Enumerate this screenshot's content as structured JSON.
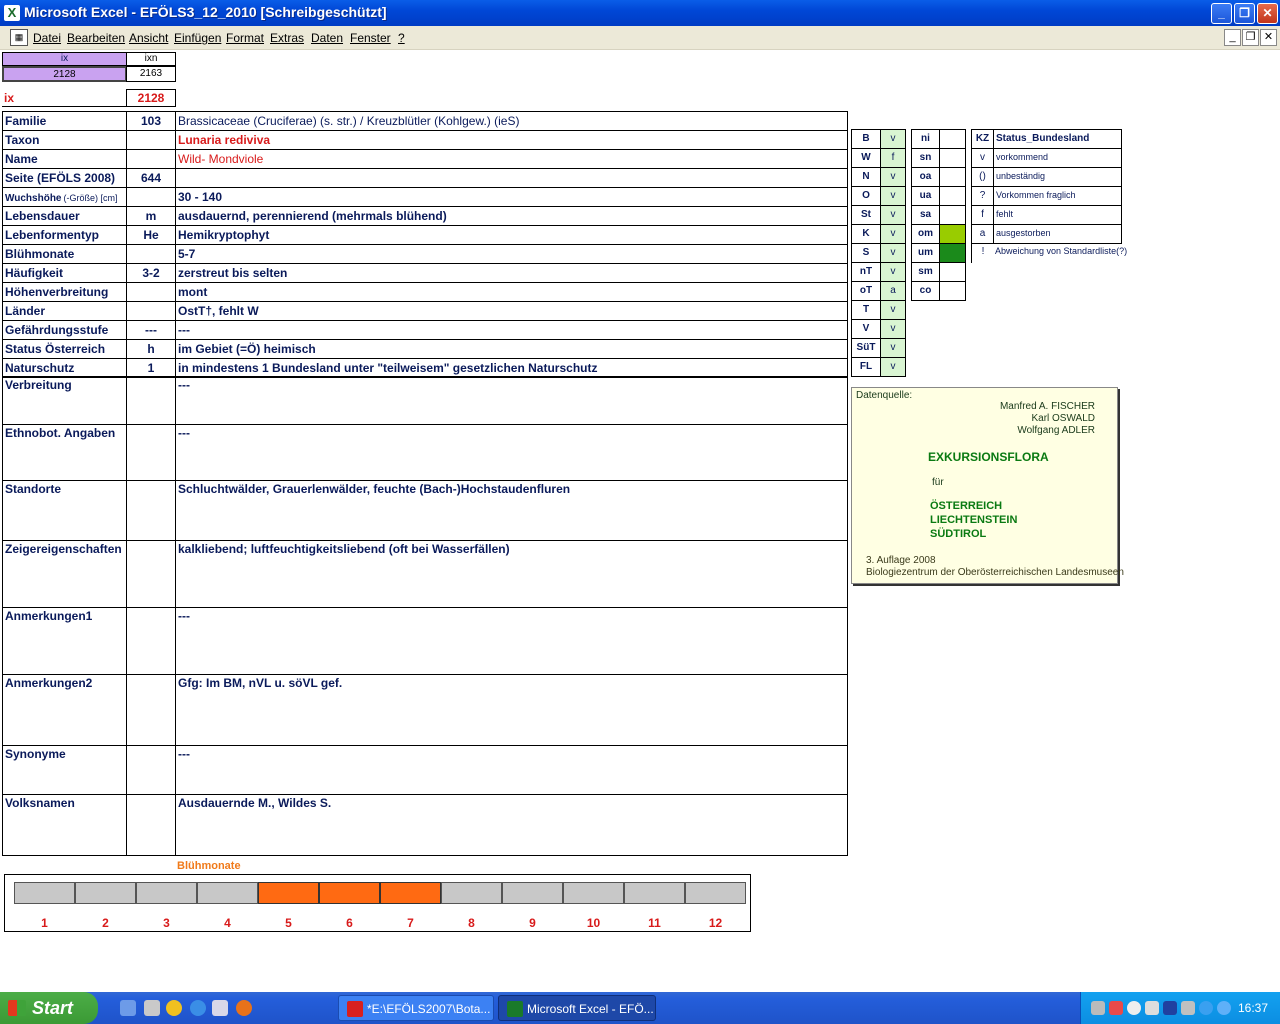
{
  "window": {
    "title": "Microsoft Excel - EFÖLS3_12_2010  [Schreibgeschützt]"
  },
  "menu": [
    "Datei",
    "Bearbeiten",
    "Ansicht",
    "Einfügen",
    "Format",
    "Extras",
    "Daten",
    "Fenster",
    "?"
  ],
  "top": {
    "ix_header": "ix",
    "ixn_header": "ixn",
    "ix_value": "2128",
    "ixn_value": "2163",
    "ix_label": "ix",
    "ix_big": "2128"
  },
  "rows": [
    {
      "label": "Familie",
      "code": "103",
      "value": "Brassicaceae (Cruciferae) (s. str.)  /  Kreuzblütler (Kohlgew.) (ieS)"
    },
    {
      "label": "Taxon",
      "code": "",
      "value": "Lunaria rediviva"
    },
    {
      "label": "Name",
      "code": "",
      "value": "Wild- Mondviole"
    },
    {
      "label": "Seite (EFÖLS 2008)",
      "code": "644",
      "value": ""
    },
    {
      "label": "Wuchshöhe",
      "label_suffix": "(-Größe) [cm]",
      "code": "",
      "value": " 30 - 140"
    },
    {
      "label": "Lebensdauer",
      "code": "m",
      "value": "ausdauernd, perennierend (mehrmals blühend)"
    },
    {
      "label": "Lebenformentyp",
      "code": "He",
      "value": "Hemikryptophyt"
    },
    {
      "label": "Blühmonate",
      "code": "",
      "value": " 5-7"
    },
    {
      "label": "Häufigkeit",
      "code": "3-2",
      "value": "zerstreut bis selten"
    },
    {
      "label": "Höhenverbreitung",
      "code": "",
      "value": "mont"
    },
    {
      "label": "Länder",
      "code": "",
      "value": "OstT†, fehlt W"
    },
    {
      "label": "Gefährdungsstufe",
      "code": "---",
      "value": "  ---"
    },
    {
      "label": "Status Österreich",
      "code": "h",
      "value": "im Gebiet (=Ö) heimisch"
    },
    {
      "label": "Naturschutz",
      "code": "1",
      "value": "in mindestens 1 Bundesland unter \"teilweisem\" gesetzlichen Naturschutz"
    }
  ],
  "big_rows": [
    {
      "label": "Verbreitung",
      "value": " ---"
    },
    {
      "label": "Ethnobot. Angaben",
      "value": "---"
    },
    {
      "label": "Standorte",
      "value": "Schluchtwälder, Grauerlenwälder, feuchte (Bach-)Hochstaudenfluren"
    },
    {
      "label": "Zeigereigenschaften",
      "value": "kalkliebend; luftfeuchtigkeitsliebend (oft bei Wasserfällen)"
    },
    {
      "label": "Anmerkungen1",
      "value": "---"
    },
    {
      "label": "Anmerkungen2",
      "value": "Gfg: Im BM, nVL u. söVL gef."
    },
    {
      "label": "Synonyme",
      "value": "---"
    },
    {
      "label": "Volksnamen",
      "value": "Ausdauernde M., Wildes S."
    }
  ],
  "states": [
    {
      "k": "B",
      "v": "v"
    },
    {
      "k": "W",
      "v": "f"
    },
    {
      "k": "N",
      "v": "v"
    },
    {
      "k": "O",
      "v": "v"
    },
    {
      "k": "St",
      "v": "v"
    },
    {
      "k": "K",
      "v": "v"
    },
    {
      "k": "S",
      "v": "v"
    },
    {
      "k": "nT",
      "v": "v"
    },
    {
      "k": "oT",
      "v": "a"
    },
    {
      "k": "T",
      "v": "v"
    },
    {
      "k": "V",
      "v": "v"
    },
    {
      "k": "SüT",
      "v": "v"
    },
    {
      "k": "FL",
      "v": "v"
    }
  ],
  "altitude": [
    {
      "k": "ni",
      "fill": ""
    },
    {
      "k": "sn",
      "fill": ""
    },
    {
      "k": "oa",
      "fill": ""
    },
    {
      "k": "ua",
      "fill": ""
    },
    {
      "k": "sa",
      "fill": ""
    },
    {
      "k": "om",
      "fill": "#99cc00"
    },
    {
      "k": "um",
      "fill": "#1b8a1b"
    },
    {
      "k": "sm",
      "fill": ""
    },
    {
      "k": "co",
      "fill": ""
    }
  ],
  "legend": {
    "kz_header": "KZ",
    "status_header": "Status_Bundesland",
    "items": [
      {
        "k": "v",
        "t": "vorkommend"
      },
      {
        "k": "()",
        "t": "unbeständig"
      },
      {
        "k": "?",
        "t": "Vorkommen fraglich"
      },
      {
        "k": "f",
        "t": "fehlt"
      },
      {
        "k": "a",
        "t": "ausgestorben"
      },
      {
        "k": "!",
        "t": "Abweichung von Standardliste(?)"
      }
    ]
  },
  "source": {
    "heading": "Datenquelle:",
    "authors": [
      "Manfred A. FISCHER",
      "Karl OSWALD",
      "Wolfgang ADLER"
    ],
    "book": "EXKURSIONSFLORA",
    "fuer": "für",
    "regions": [
      "ÖSTERREICH",
      "LIECHTENSTEIN",
      "SÜDTIROL"
    ],
    "edition": "3. Auflage 2008",
    "publisher": "Biologiezentrum der Oberösterreichischen Landesmuseen"
  },
  "bloom": {
    "title": "Blühmonate",
    "months": [
      "1",
      "2",
      "3",
      "4",
      "5",
      "6",
      "7",
      "8",
      "9",
      "10",
      "11",
      "12"
    ],
    "active": [
      false,
      false,
      false,
      false,
      true,
      true,
      true,
      false,
      false,
      false,
      false,
      false
    ]
  },
  "taskbar": {
    "start": "Start",
    "buttons": [
      "*E:\\EFÖLS2007\\Bota...",
      "Microsoft Excel - EFÖ..."
    ],
    "clock": "16:37"
  }
}
